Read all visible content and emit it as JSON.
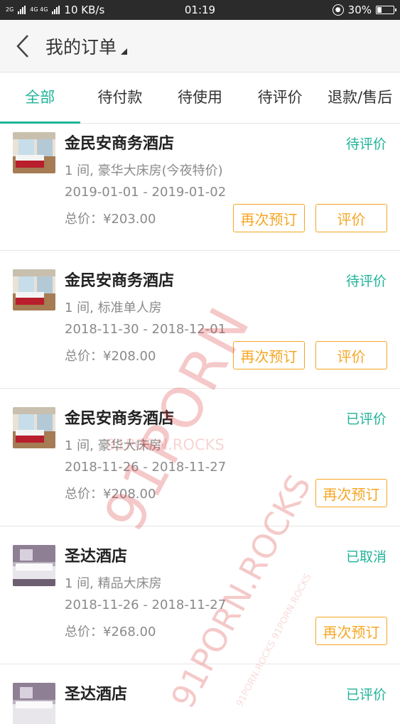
{
  "status_bar": {
    "network_left": "2G",
    "network_right": "4G 4G",
    "speed": "10 KB/s",
    "time": "01:19",
    "battery": "30%"
  },
  "header": {
    "title": "我的订单"
  },
  "tabs": [
    {
      "label": "全部",
      "active": true
    },
    {
      "label": "待付款",
      "active": false
    },
    {
      "label": "待使用",
      "active": false
    },
    {
      "label": "待评价",
      "active": false
    },
    {
      "label": "退款/售后",
      "active": false
    }
  ],
  "orders": [
    {
      "hotel": "金民安商务酒店",
      "status": "待评价",
      "room": "1 间, 豪华大床房(今夜特价)",
      "dates": "2019-01-01 - 2019-01-02",
      "price": "总价：¥203.00",
      "rebook_label": "再次预订",
      "rate_label": "评价"
    },
    {
      "hotel": "金民安商务酒店",
      "status": "待评价",
      "room": "1 间, 标准单人房",
      "dates": "2018-11-30 - 2018-12-01",
      "price": "总价：¥208.00",
      "rebook_label": "再次预订",
      "rate_label": "评价"
    },
    {
      "hotel": "金民安商务酒店",
      "status": "已评价",
      "room": "1 间, 豪华大床房",
      "dates": "2018-11-26 - 2018-11-27",
      "price": "总价：¥208.00",
      "rebook_label": "再次预订"
    },
    {
      "hotel": "圣达酒店",
      "status": "已取消",
      "room": "1 间, 精品大床房",
      "dates": "2018-11-26 - 2018-11-27",
      "price": "总价：¥268.00",
      "rebook_label": "再次预订"
    },
    {
      "hotel": "圣达酒店",
      "status": "已评价"
    }
  ],
  "watermark": {
    "big": "91PORN",
    "mid": "91PORN.ROCKS",
    "small": "91PORN.ROCKS 91PORN.ROCKS"
  },
  "colors": {
    "accent": "#20b39a",
    "button": "#f5a623",
    "status_bar": "#2b2b2b"
  }
}
